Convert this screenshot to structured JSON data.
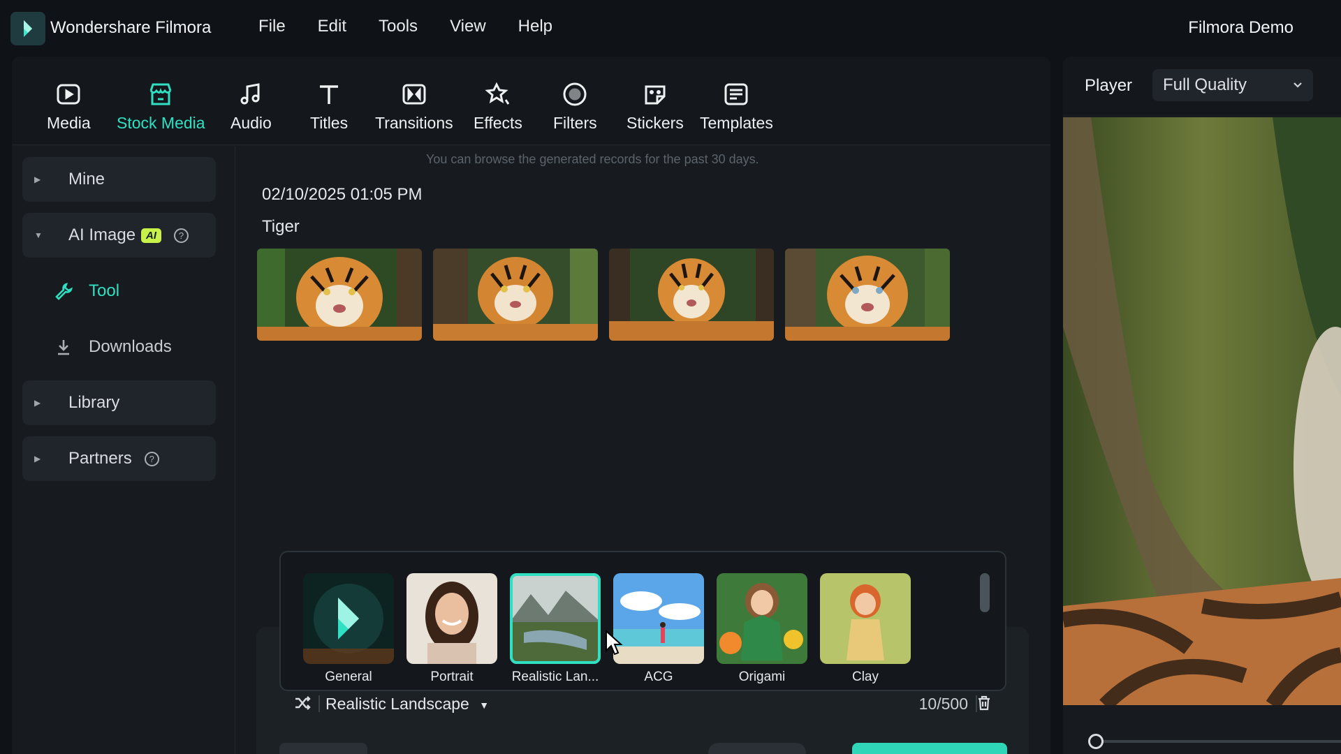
{
  "app": {
    "name": "Wondershare Filmora",
    "project": "Filmora Demo"
  },
  "menu": [
    "File",
    "Edit",
    "Tools",
    "View",
    "Help"
  ],
  "toolbar": {
    "items": [
      {
        "label": "Media",
        "icon": "media-icon"
      },
      {
        "label": "Stock Media",
        "icon": "stock-media-icon",
        "active": true
      },
      {
        "label": "Audio",
        "icon": "music-note-icon"
      },
      {
        "label": "Titles",
        "icon": "text-t-icon"
      },
      {
        "label": "Transitions",
        "icon": "transitions-icon"
      },
      {
        "label": "Effects",
        "icon": "effects-icon"
      },
      {
        "label": "Filters",
        "icon": "filters-icon"
      },
      {
        "label": "Stickers",
        "icon": "stickers-icon"
      },
      {
        "label": "Templates",
        "icon": "templates-icon"
      }
    ]
  },
  "sidebar": {
    "mine": "Mine",
    "ai_image": "AI Image",
    "ai_badge": "AI",
    "tool": "Tool",
    "downloads": "Downloads",
    "library": "Library",
    "partners": "Partners"
  },
  "content": {
    "hint": "You can browse the generated records for the past 30 days.",
    "timestamp": "02/10/2025 01:05 PM",
    "prompt": "Tiger",
    "result_count": 4
  },
  "styles": {
    "items": [
      "General",
      "Portrait",
      "Realistic Lan...",
      "ACG",
      "Origami",
      "Clay"
    ],
    "selected_index": 2,
    "selected_label": "Realistic Landscape",
    "char_count": "10/500"
  },
  "player": {
    "label": "Player",
    "quality": "Full Quality",
    "progress": 0
  },
  "colors": {
    "accent": "#2fe0c2",
    "ai_badge": "#c6f24a",
    "background": "#0f1216",
    "panel": "#171b20"
  }
}
